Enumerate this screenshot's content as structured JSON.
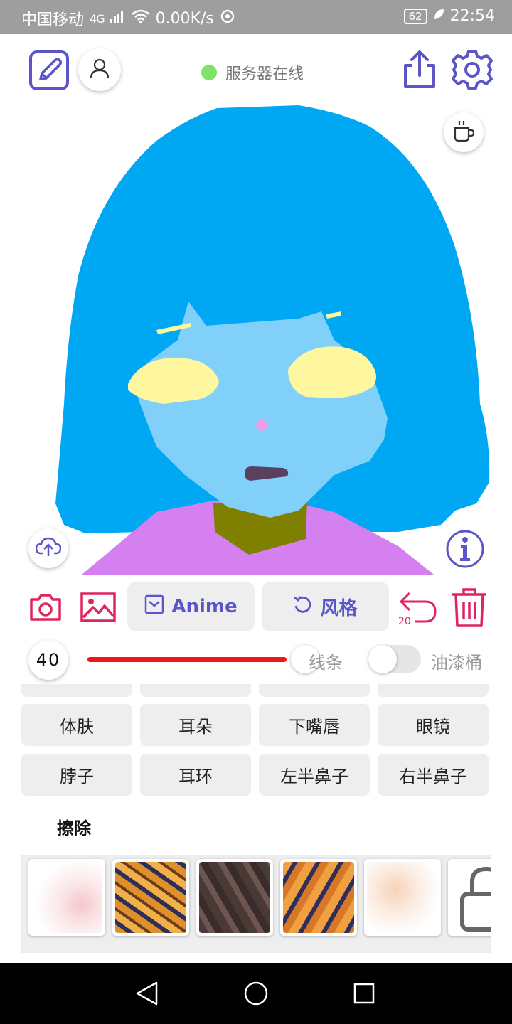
{
  "status_bar": {
    "carrier": "中国移动",
    "network": "4G",
    "speed": "0.00K/s",
    "battery": "62",
    "time": "22:54"
  },
  "header": {
    "server_status": "服务器在线",
    "server_status_color": "#7ee36a"
  },
  "toolbar": {
    "anime_label": "Anime",
    "style_label": "风格",
    "undo_count": "20"
  },
  "brush": {
    "size": "40",
    "size_fraction": 0.9,
    "line_label": "线条",
    "bucket_label": "油漆桶",
    "bucket_enabled": false
  },
  "parts": {
    "items": [
      "体肤",
      "耳朵",
      "下嘴唇",
      "眼镜",
      "脖子",
      "耳环",
      "左半鼻子",
      "右半鼻子"
    ]
  },
  "eraser": {
    "title": "擦除"
  },
  "textures": [
    {
      "name": "texture-pink-splatter"
    },
    {
      "name": "texture-orange-navy-swirl"
    },
    {
      "name": "texture-brown-leaves"
    },
    {
      "name": "texture-orange-navy-leaves"
    },
    {
      "name": "texture-peach-feathers"
    },
    {
      "name": "texture-locked"
    }
  ],
  "colors": {
    "accent": "#5b55c8",
    "danger": "#e0245e",
    "slider": "#f01616",
    "hair": "#00a8f3",
    "skin": "#80d0fa",
    "eyes": "#fff6a0",
    "shirt": "#d480f0",
    "neck": "#808000",
    "mouth": "#5a4060"
  }
}
